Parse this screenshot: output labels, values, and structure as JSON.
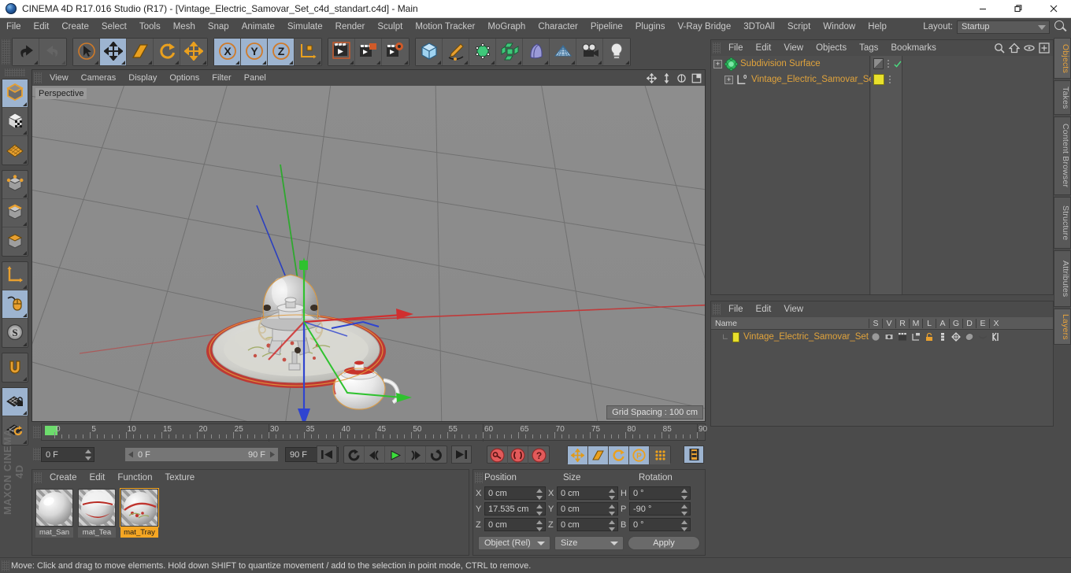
{
  "titlebar": {
    "title": "CINEMA 4D R17.016 Studio (R17) - [Vintage_Electric_Samovar_Set_c4d_standart.c4d] - Main",
    "minimize": "—",
    "maximize": "❐",
    "close": "✕"
  },
  "menubar": {
    "items": [
      "File",
      "Edit",
      "Create",
      "Select",
      "Tools",
      "Mesh",
      "Snap",
      "Animate",
      "Simulate",
      "Render",
      "Sculpt",
      "Motion Tracker",
      "MoGraph",
      "Character",
      "Pipeline",
      "Plugins",
      "V-Ray Bridge",
      "3DToAll",
      "Script",
      "Window",
      "Help"
    ],
    "layout_label": "Layout:",
    "layout_value": "Startup"
  },
  "toolbar": {
    "groups": [
      {
        "name": "undo-redo",
        "buttons": [
          {
            "name": "undo-button",
            "icon": "undo-icon"
          },
          {
            "name": "redo-button",
            "icon": "redo-icon",
            "disabled": true
          }
        ]
      },
      {
        "name": "transform-tools",
        "buttons": [
          {
            "name": "live-selection-button",
            "icon": "cursor-icon"
          },
          {
            "name": "move-tool-button",
            "icon": "move-icon",
            "selected": true
          },
          {
            "name": "scale-tool-button",
            "icon": "scale-icon"
          },
          {
            "name": "rotate-tool-button",
            "icon": "rotate-icon"
          },
          {
            "name": "move-alt-button",
            "icon": "move-icon"
          }
        ]
      },
      {
        "name": "axis-locks",
        "buttons": [
          {
            "name": "lock-x-button",
            "icon": "x-axis-icon",
            "selected": true
          },
          {
            "name": "lock-y-button",
            "icon": "y-axis-icon",
            "selected": true
          },
          {
            "name": "lock-z-button",
            "icon": "z-axis-icon",
            "selected": true
          },
          {
            "name": "world-object-coords-button",
            "icon": "world-axis-icon"
          }
        ]
      },
      {
        "name": "render-tools",
        "buttons": [
          {
            "name": "render-view-button",
            "icon": "render-view-icon"
          },
          {
            "name": "render-region-button",
            "icon": "render-region-icon"
          },
          {
            "name": "render-settings-button",
            "icon": "render-settings-icon"
          }
        ]
      },
      {
        "name": "create-objects",
        "buttons": [
          {
            "name": "add-cube-button",
            "icon": "cube-icon"
          },
          {
            "name": "add-spline-button",
            "icon": "pen-icon"
          },
          {
            "name": "add-generator-button",
            "icon": "nurbs-icon"
          },
          {
            "name": "add-deformer-button",
            "icon": "array-icon"
          },
          {
            "name": "add-scene-button",
            "icon": "bend-icon"
          },
          {
            "name": "add-floor-button",
            "icon": "floor-icon"
          },
          {
            "name": "add-camera-button",
            "icon": "camera-icon"
          },
          {
            "name": "add-light-button",
            "icon": "light-icon"
          }
        ]
      }
    ]
  },
  "lefttoolbar": {
    "groups": [
      {
        "name": "mode-group-1",
        "buttons": [
          {
            "name": "make-editable-button",
            "icon": "editable-cube-icon",
            "selected": true
          },
          {
            "name": "model-mode-button",
            "icon": "texture-cube-icon"
          },
          {
            "name": "texture-mode-button",
            "icon": "grid-plane-icon"
          }
        ]
      },
      {
        "name": "component-group",
        "buttons": [
          {
            "name": "points-mode-button",
            "icon": "points-cube-icon"
          },
          {
            "name": "edges-mode-button",
            "icon": "edges-cube-icon"
          },
          {
            "name": "polygons-mode-button",
            "icon": "polygons-cube-icon"
          }
        ]
      },
      {
        "name": "axis-group",
        "buttons": [
          {
            "name": "enable-axis-button",
            "icon": "axis-icon"
          },
          {
            "name": "viewport-solo-button",
            "icon": "mouse-icon",
            "selected": true
          },
          {
            "name": "soft-selection-button",
            "icon": "soft-selection-icon"
          }
        ]
      },
      {
        "name": "snap-group",
        "buttons": [
          {
            "name": "enable-snap-button",
            "icon": "magnet-icon"
          }
        ]
      },
      {
        "name": "workplane-group",
        "buttons": [
          {
            "name": "lock-workplane-button",
            "icon": "workplane-lock-icon",
            "selected": true
          },
          {
            "name": "workplane-rotate-button",
            "icon": "workplane-rotate-icon"
          }
        ]
      }
    ],
    "brand": "MAXON CINEMA 4D"
  },
  "viewport": {
    "menu": [
      "View",
      "Cameras",
      "Display",
      "Options",
      "Filter",
      "Panel"
    ],
    "icons": [
      "pan-icon",
      "dolly-icon",
      "orbit-icon",
      "maximize-viewport-icon"
    ],
    "label": "Perspective",
    "grid_spacing": "Grid Spacing : 100 cm",
    "axis_gizmo": {
      "x": "X",
      "y": "Y",
      "z": "Z"
    }
  },
  "timeline": {
    "ticks": [
      0,
      5,
      10,
      15,
      20,
      25,
      30,
      35,
      40,
      45,
      50,
      55,
      60,
      65,
      70,
      75,
      80,
      85,
      90
    ],
    "current_frame_field": "0 F",
    "range_start": "0 F",
    "range_end": "90 F",
    "max_frame_field": "90 F",
    "end_frame_field": "0 F"
  },
  "playbar": {
    "buttons": [
      {
        "name": "goto-start-button",
        "icon": "skip-start-icon"
      },
      {
        "name": "play-backwards-button",
        "icon": "rewind-icon"
      },
      {
        "name": "step-back-button",
        "icon": "step-back-icon"
      },
      {
        "name": "play-button",
        "icon": "play-icon"
      },
      {
        "name": "step-forward-button",
        "icon": "step-forward-icon"
      },
      {
        "name": "loop-button",
        "icon": "loop-icon"
      },
      {
        "name": "goto-end-button",
        "icon": "skip-end-icon"
      }
    ],
    "key_buttons": [
      {
        "name": "record-keyframe-button",
        "icon": "key-icon"
      },
      {
        "name": "autokey-button",
        "icon": "autokey-icon"
      },
      {
        "name": "keyframe-selection-button",
        "icon": "question-icon"
      }
    ],
    "record_toggles": [
      {
        "name": "record-position-button",
        "icon": "move-icon",
        "selected": true
      },
      {
        "name": "record-scale-button",
        "icon": "scale-icon",
        "selected": true
      },
      {
        "name": "record-rotation-button",
        "icon": "rotate-icon",
        "selected": true
      },
      {
        "name": "record-param-button",
        "icon": "param-icon",
        "selected": true
      },
      {
        "name": "record-pla-button",
        "icon": "dots-icon"
      }
    ],
    "timeline_button": {
      "name": "open-timeline-button",
      "icon": "film-icon"
    }
  },
  "materials": {
    "menu": [
      "Create",
      "Edit",
      "Function",
      "Texture"
    ],
    "items": [
      {
        "name": "mat_San",
        "selected": false
      },
      {
        "name": "mat_Tea",
        "selected": false
      },
      {
        "name": "mat_Tray",
        "selected": true
      }
    ]
  },
  "coordinates": {
    "headers": [
      "Position",
      "Size",
      "Rotation"
    ],
    "position": [
      {
        "axis": "X",
        "value": "0 cm"
      },
      {
        "axis": "Y",
        "value": "17.535 cm"
      },
      {
        "axis": "Z",
        "value": "0 cm"
      }
    ],
    "size": [
      {
        "axis": "X",
        "value": "0 cm"
      },
      {
        "axis": "Y",
        "value": "0 cm"
      },
      {
        "axis": "Z",
        "value": "0 cm"
      }
    ],
    "rotation": [
      {
        "axis": "H",
        "value": "0 °"
      },
      {
        "axis": "P",
        "value": "-90 °"
      },
      {
        "axis": "B",
        "value": "0 °"
      }
    ],
    "coord_system": "Object (Rel)",
    "size_mode": "Size",
    "apply_label": "Apply"
  },
  "objects_manager": {
    "menu": [
      "File",
      "Edit",
      "View",
      "Objects",
      "Tags",
      "Bookmarks"
    ],
    "tools": [
      "search-icon",
      "home-icon",
      "eye-icon",
      "new-layer-icon"
    ],
    "rows": [
      {
        "label": "Subdivision Surface",
        "icon": "subdivision-surface-icon",
        "indent": 0,
        "tag": "gray",
        "check": true
      },
      {
        "label": "Vintage_Electric_Samovar_Set",
        "icon": "null-object-icon",
        "indent": 1,
        "tag": "yellow",
        "check": false
      }
    ]
  },
  "layers_manager": {
    "menu": [
      "File",
      "Edit",
      "View"
    ],
    "columns": [
      "Name",
      "S",
      "V",
      "R",
      "M",
      "L",
      "A",
      "G",
      "D",
      "E",
      "X"
    ],
    "rows": [
      {
        "name": "Vintage_Electric_Samovar_Set",
        "color": "#e8e02c"
      }
    ]
  },
  "right_tabs": [
    {
      "label": "Objects",
      "active": true
    },
    {
      "label": "Takes",
      "active": false
    },
    {
      "label": "Content Browser",
      "active": false
    },
    {
      "label": "Structure",
      "active": false
    },
    {
      "label": "Attributes",
      "active": false
    },
    {
      "label": "Layers",
      "active": true
    }
  ],
  "statusbar": {
    "text": "Move: Click and drag to move elements. Hold down SHIFT to quantize movement / add to the selection in point mode, CTRL to remove."
  },
  "colors": {
    "accent_orange": "#e0a33c",
    "selected_blue": "#9db4d0",
    "panel_bg": "#4b4b4b",
    "field_bg": "#3b3b3b",
    "axis_x": "#d04040",
    "axis_y": "#3ec13e",
    "axis_z": "#3a56d0"
  }
}
